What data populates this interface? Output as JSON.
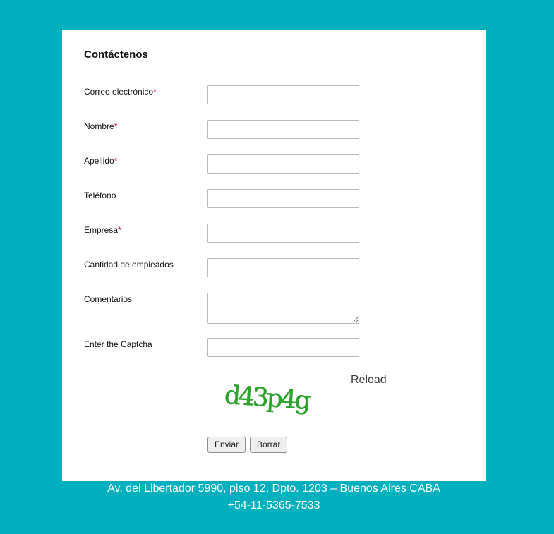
{
  "form": {
    "title": "Contáctenos",
    "required_mark": "*",
    "fields": [
      {
        "label": "Correo electrónico",
        "required": true,
        "value": ""
      },
      {
        "label": "Nombre",
        "required": true,
        "value": ""
      },
      {
        "label": "Apellido",
        "required": true,
        "value": ""
      },
      {
        "label": "Teléfono",
        "required": false,
        "value": ""
      },
      {
        "label": "Empresa",
        "required": true,
        "value": ""
      },
      {
        "label": "Cantidad de empleados",
        "required": false,
        "value": ""
      },
      {
        "label": "Comentarios",
        "required": false,
        "value": ""
      },
      {
        "label": "Enter the Captcha",
        "required": false,
        "value": ""
      }
    ],
    "captcha_text": "d43p4g",
    "reload_label": "Reload",
    "submit_label": "Enviar",
    "reset_label": "Borrar"
  },
  "footer": {
    "address": "Av. del Libertador 5990, piso 12, Dpto. 1203 – Buenos Aires CABA",
    "phone": "+54-11-5365-7533"
  },
  "colors": {
    "page_background": "#00b0bf",
    "card_background": "#ffffff",
    "required_mark": "#d0021b",
    "captcha_text": "#2ea32e"
  }
}
